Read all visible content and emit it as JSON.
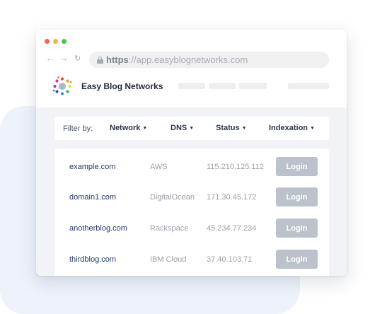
{
  "browser": {
    "url_scheme": "https",
    "url_rest": "://app.easyblognetworks.com",
    "window_dots": [
      "#f2665a",
      "#f5b83a",
      "#4fc24d"
    ],
    "back_icon": "arrow-left-icon",
    "forward_icon": "arrow-right-icon",
    "reload_icon": "reload-icon",
    "lock_icon": "lock-icon"
  },
  "app": {
    "brand": "Easy Blog Networks",
    "logo_icon": "dots-circle-logo"
  },
  "filters": {
    "label": "Filter by:",
    "items": [
      "Network",
      "DNS",
      "Status",
      "Indexation"
    ]
  },
  "sites": [
    {
      "domain": "example.com",
      "provider": "AWS",
      "ip": "115.210.125.112",
      "action": "Login"
    },
    {
      "domain": "domain1.com",
      "provider": "DigitalOcean",
      "ip": "171.30.45.172",
      "action": "Login"
    },
    {
      "domain": "anotherblog.com",
      "provider": "Rackspace",
      "ip": "45.234.77.234",
      "action": "Login"
    },
    {
      "domain": "thirdblog.com",
      "provider": "IBM Cloud",
      "ip": "37.40.103.71",
      "action": "Login"
    }
  ],
  "colors": {
    "domain_text": "#233a6a",
    "login_button": "#bcc2cc",
    "background_accent": "#eef3fb"
  }
}
